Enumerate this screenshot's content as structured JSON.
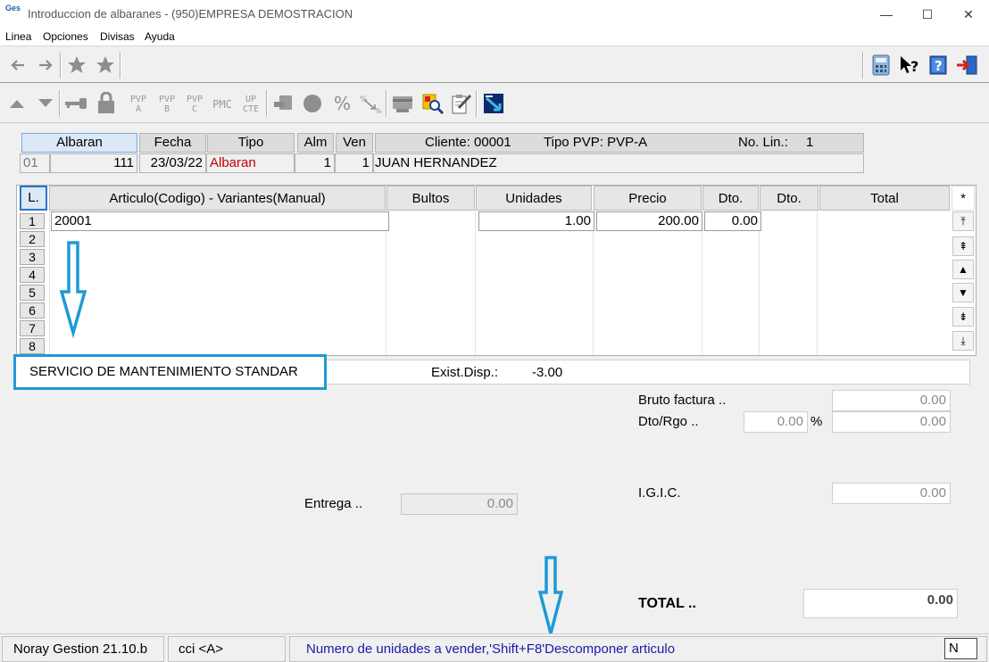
{
  "window": {
    "title": "Introduccion de albaranes -  (950)EMPRESA DEMOSTRACION",
    "app_icon_text": "Ges",
    "controls": {
      "minimize": "—",
      "maximize": "☐",
      "close": "✕"
    }
  },
  "menu": [
    "Linea",
    "Opciones",
    "Divisas",
    "Ayuda"
  ],
  "toolbar2_text": {
    "pvp_a": [
      "PVP",
      "A"
    ],
    "pvp_b": [
      "PVP",
      "B"
    ],
    "pvp_c": [
      "PVP",
      "C"
    ],
    "pmc": "PMC",
    "up_cte": [
      "UP",
      "CTE"
    ]
  },
  "header": {
    "labels": {
      "albaran": "Albaran",
      "fecha": "Fecha",
      "tipo": "Tipo",
      "alm": "Alm",
      "ven": "Ven",
      "cliente": "Cliente: 00001",
      "tipo_pvp": "Tipo PVP: PVP-A",
      "no_lin": "No. Lin.:",
      "no_lin_value": "1"
    },
    "values": {
      "serie": "01",
      "numero": "111",
      "fecha": "23/03/22",
      "tipo": "Albaran",
      "alm": "1",
      "ven": "1",
      "cliente_nombre": "JUAN HERNANDEZ"
    }
  },
  "grid": {
    "columns": [
      "L.",
      "Articulo(Codigo)  -  Variantes(Manual)",
      "Bultos",
      "Unidades",
      "Precio",
      "Dto.",
      "Dto.",
      "Total",
      "*"
    ],
    "row_numbers": [
      "1",
      "2",
      "3",
      "4",
      "5",
      "6",
      "7",
      "8"
    ],
    "rows": [
      {
        "articulo": "20001",
        "unidades": "1.00",
        "precio": "200.00",
        "dto": "0.00"
      }
    ],
    "scroll_buttons": [
      "⤒",
      "⇞",
      "▲",
      "▼",
      "⇟",
      "⤓"
    ]
  },
  "description": {
    "text": "SERVICIO DE MANTENIMIENTO STANDAR",
    "exist_label": "Exist.Disp.:",
    "exist_value": "-3.00"
  },
  "totals": {
    "bruto_label": "Bruto factura ..",
    "bruto_value": "0.00",
    "dto_label": "Dto/Rgo ..",
    "dto_percent": "0.00",
    "percent_sign": "%",
    "dto_value": "0.00",
    "igic_label": "I.G.I.C.",
    "igic_value": "0.00",
    "entrega_label": "Entrega ..",
    "entrega_value": "0.00",
    "total_label": "TOTAL ..",
    "total_value": "0.00"
  },
  "statusbar": {
    "app": "Noray Gestion 21.10.b",
    "user": "cci <A>",
    "message": "Numero de unidades a vender,'Shift+F8'Descomponer articulo",
    "mode": "N"
  },
  "colors": {
    "annotation": "#1d9ad6",
    "tipo_text": "#c00000",
    "status_message": "#1a1aa6",
    "selected_header": "#dbe9f7"
  }
}
